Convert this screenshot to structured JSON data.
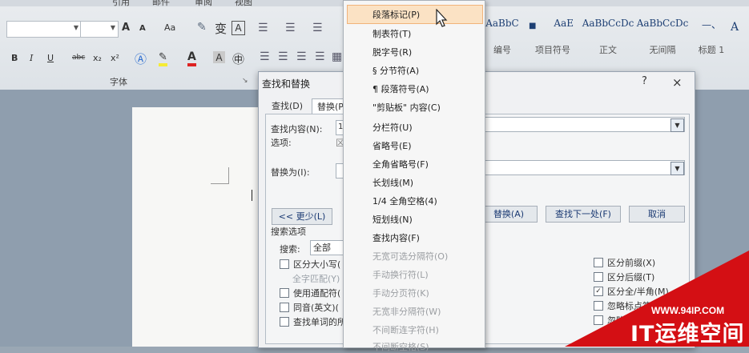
{
  "ribbon": {
    "tabs": [
      "引用",
      "邮件",
      "审阅",
      "视图"
    ],
    "font_group_label": "字体",
    "font_size_grow": "A",
    "font_size_shrink": "A",
    "change_case": "Aa",
    "phonetic": "变",
    "char_border": "A",
    "bold": "B",
    "italic": "I",
    "underline": "U",
    "strike": "abc",
    "subscript": "x₂",
    "superscript": "x²",
    "font_color": "A",
    "char_shading": "A",
    "styles": [
      {
        "preview": "AaBbC",
        "name": "编号"
      },
      {
        "preview": "AaE",
        "name": "项目符号"
      },
      {
        "preview": "AaBbCcDc",
        "name": "正文"
      },
      {
        "preview": "AaBbCcDc",
        "name": "无间隔"
      },
      {
        "preview": "—、",
        "name": "标题 1"
      }
    ]
  },
  "dialog": {
    "title": "查找和替换",
    "help": "?",
    "close": "×",
    "tabs": [
      "查找(D)",
      "替换(P)"
    ],
    "find_label": "查找内容(N):",
    "find_value": "1",
    "options_label": "选项:",
    "options_value": "区",
    "replace_label": "替换为(I):",
    "less_button": "<< 更少(L)",
    "replace_button": "替换(A)",
    "find_next_button": "查找下一处(F)",
    "cancel_button": "取消",
    "search_options_label": "搜索选项",
    "search_label": "搜索:",
    "search_value": "全部",
    "left_options": [
      {
        "label": "区分大小写(",
        "checked": false,
        "dim": false
      },
      {
        "label": "全字匹配(Y)",
        "checked": false,
        "dim": true
      },
      {
        "label": "使用通配符(",
        "checked": false,
        "dim": false
      },
      {
        "label": "同音(英文)(",
        "checked": false,
        "dim": false
      },
      {
        "label": "查找单词的所",
        "checked": false,
        "dim": false
      }
    ],
    "right_options": [
      {
        "label": "区分前缀(X)",
        "checked": false
      },
      {
        "label": "区分后缀(T)",
        "checked": false
      },
      {
        "label": "区分全/半角(M)",
        "checked": true
      },
      {
        "label": "忽略标点符号",
        "checked": false
      },
      {
        "label": "忽略空格",
        "checked": false
      }
    ]
  },
  "special_menu": {
    "items": [
      {
        "label": "段落标记(P)",
        "highlight": true,
        "dim": false
      },
      {
        "label": "制表符(T)",
        "dim": false
      },
      {
        "label": "脱字号(R)",
        "dim": false
      },
      {
        "label": "§ 分节符(A)",
        "dim": false
      },
      {
        "label": "¶ 段落符号(A)",
        "dim": false
      },
      {
        "label": "\"剪贴板\" 内容(C)",
        "dim": false
      },
      {
        "label": "分栏符(U)",
        "dim": false
      },
      {
        "label": "省略号(E)",
        "dim": false
      },
      {
        "label": "全角省略号(F)",
        "dim": false
      },
      {
        "label": "长划线(M)",
        "dim": false
      },
      {
        "label": "1/4 全角空格(4)",
        "dim": false
      },
      {
        "label": "短划线(N)",
        "dim": false
      },
      {
        "label": "查找内容(F)",
        "dim": false
      },
      {
        "label": "无宽可选分隔符(O)",
        "dim": true
      },
      {
        "label": "手动换行符(L)",
        "dim": true
      },
      {
        "label": "手动分页符(K)",
        "dim": true
      },
      {
        "label": "无宽非分隔符(W)",
        "dim": true
      },
      {
        "label": "不间断连字符(H)",
        "dim": true
      },
      {
        "label": "不间断空格(S)",
        "dim": true
      }
    ]
  },
  "watermark": {
    "url": "WWW.94IP.COM",
    "brand": "IT运维空间"
  }
}
